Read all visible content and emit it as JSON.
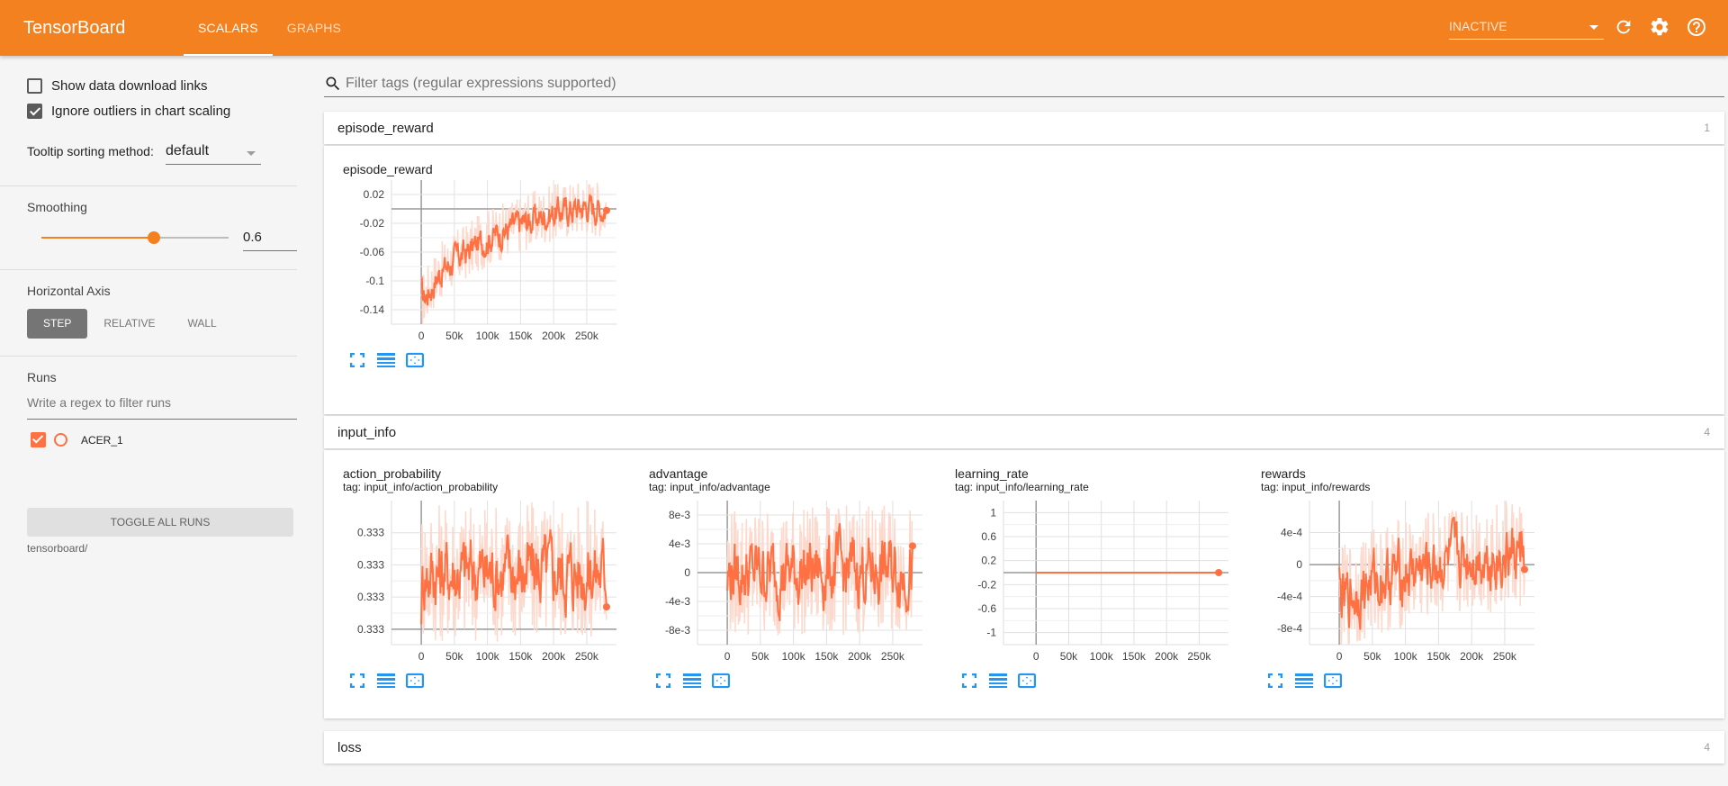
{
  "header": {
    "title": "TensorBoard",
    "tabs": [
      {
        "label": "SCALARS",
        "active": true
      },
      {
        "label": "GRAPHS",
        "active": false
      }
    ],
    "status": "INACTIVE",
    "icons": [
      "refresh-icon",
      "settings-gear-icon",
      "help-icon"
    ]
  },
  "sidebar": {
    "show_download_links": {
      "label": "Show data download links",
      "checked": false
    },
    "ignore_outliers": {
      "label": "Ignore outliers in chart scaling",
      "checked": true
    },
    "tooltip_sort": {
      "label": "Tooltip sorting method:",
      "value": "default"
    },
    "smoothing": {
      "label": "Smoothing",
      "value": "0.6",
      "fraction": 0.6
    },
    "horizontal_axis": {
      "label": "Horizontal Axis",
      "options": [
        "STEP",
        "RELATIVE",
        "WALL"
      ],
      "selected": "STEP"
    },
    "runs": {
      "label": "Runs",
      "filter_placeholder": "Write a regex to filter runs",
      "items": [
        {
          "name": "ACER_1",
          "checked": true,
          "color": "#ff7043"
        }
      ],
      "toggle_label": "TOGGLE ALL RUNS",
      "logdir": "tensorboard/"
    }
  },
  "main": {
    "filter_placeholder": "Filter tags (regular expressions supported)",
    "groups": [
      {
        "name": "episode_reward",
        "count": "1"
      },
      {
        "name": "input_info",
        "count": "4"
      },
      {
        "name": "loss",
        "count": "4"
      }
    ]
  },
  "colors": {
    "brand": "#f48120",
    "run": "#ff7043",
    "run_light": "#fcd9cc",
    "action_icon": "#2196f3"
  },
  "chart_data": [
    {
      "type": "line",
      "title": "episode_reward",
      "tag": "",
      "x_ticks": [
        "0",
        "50k",
        "100k",
        "150k",
        "200k",
        "250k"
      ],
      "y_ticks": [
        "0.02",
        "-0.02",
        "-0.06",
        "-0.1",
        "-0.14"
      ],
      "y_tick_values": [
        0.02,
        -0.02,
        -0.06,
        -0.1,
        -0.14
      ],
      "xlim": [
        -45000,
        295000
      ],
      "ylim": [
        -0.16,
        0.04
      ],
      "trend": {
        "x": [
          0,
          25000,
          50000,
          100000,
          150000,
          200000,
          250000,
          280000
        ],
        "y": [
          -0.13,
          -0.09,
          -0.07,
          -0.04,
          -0.02,
          -0.005,
          0.005,
          0.0
        ]
      },
      "noise": 0.04,
      "series": [
        {
          "name": "ACER_1"
        }
      ]
    },
    {
      "type": "line",
      "title": "action_probability",
      "tag": "tag: input_info/action_probability",
      "x_ticks": [
        "0",
        "50k",
        "100k",
        "150k",
        "200k",
        "250k"
      ],
      "y_ticks": [
        "0.333",
        "0.333",
        "0.333",
        "0.333"
      ],
      "y_tick_values": [
        0.75,
        0.5,
        0.25,
        0.0
      ],
      "xlim": [
        -45000,
        295000
      ],
      "ylim": [
        -0.12,
        1.0
      ],
      "trend": {
        "x": [
          0,
          280000
        ],
        "y": [
          0.45,
          0.45
        ]
      },
      "noise": 0.55,
      "series": [
        {
          "name": "ACER_1"
        }
      ]
    },
    {
      "type": "line",
      "title": "advantage",
      "tag": "tag: input_info/advantage",
      "x_ticks": [
        "0",
        "50k",
        "100k",
        "150k",
        "200k",
        "250k"
      ],
      "y_ticks": [
        "8e-3",
        "4e-3",
        "0",
        "-4e-3",
        "-8e-3"
      ],
      "y_tick_values": [
        0.008,
        0.004,
        0,
        -0.004,
        -0.008
      ],
      "xlim": [
        -45000,
        295000
      ],
      "ylim": [
        -0.01,
        0.01
      ],
      "trend": {
        "x": [
          0,
          280000
        ],
        "y": [
          0.0,
          0.0005
        ]
      },
      "noise": 0.009,
      "series": [
        {
          "name": "ACER_1"
        }
      ]
    },
    {
      "type": "line",
      "title": "learning_rate",
      "tag": "tag: input_info/learning_rate",
      "x_ticks": [
        "0",
        "50k",
        "100k",
        "150k",
        "200k",
        "250k"
      ],
      "y_ticks": [
        "1",
        "0.6",
        "0.2",
        "-0.2",
        "-0.6",
        "-1"
      ],
      "y_tick_values": [
        1,
        0.6,
        0.2,
        -0.2,
        -0.6,
        -1
      ],
      "xlim": [
        -50000,
        295000
      ],
      "ylim": [
        -1.2,
        1.2
      ],
      "trend": {
        "x": [
          0,
          280000
        ],
        "y": [
          0,
          0
        ]
      },
      "noise": 0,
      "series": [
        {
          "name": "ACER_1"
        }
      ]
    },
    {
      "type": "line",
      "title": "rewards",
      "tag": "tag: input_info/rewards",
      "x_ticks": [
        "0",
        "50k",
        "100k",
        "150k",
        "200k",
        "250k"
      ],
      "y_ticks": [
        "4e-4",
        "0",
        "-4e-4",
        "-8e-4"
      ],
      "y_tick_values": [
        0.0004,
        0,
        -0.0004,
        -0.0008
      ],
      "xlim": [
        -45000,
        295000
      ],
      "ylim": [
        -0.001,
        0.0008
      ],
      "trend": {
        "x": [
          0,
          50000,
          100000,
          150000,
          200000,
          250000,
          280000
        ],
        "y": [
          -0.0005,
          -0.0002,
          -0.0001,
          0.0,
          0.0001,
          0.0001,
          0.00015
        ]
      },
      "noise": 0.0007,
      "series": [
        {
          "name": "ACER_1"
        }
      ]
    }
  ]
}
